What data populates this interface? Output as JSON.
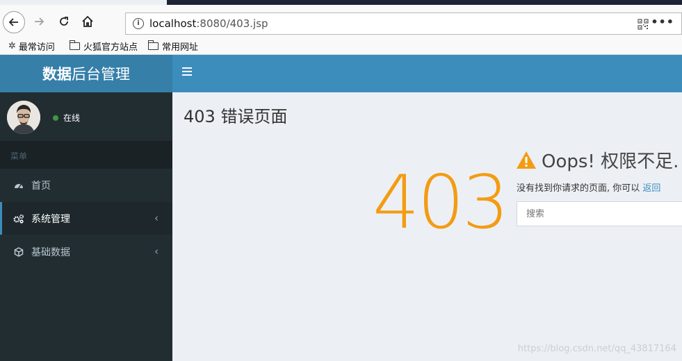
{
  "browser": {
    "url_host": "localhost",
    "url_path": ":8080/403.jsp",
    "more_label": "•••",
    "bookmarks": [
      {
        "label": "最常访问",
        "icon": "gear-icon"
      },
      {
        "label": "火狐官方站点",
        "icon": "folder-icon"
      },
      {
        "label": "常用网址",
        "icon": "folder-icon"
      }
    ]
  },
  "app": {
    "logo_bold": "数据",
    "logo_rest": "后台管理"
  },
  "sidebar": {
    "status": "在线",
    "menu_header": "菜单",
    "items": [
      {
        "label": "首页",
        "icon": "dashboard-icon"
      },
      {
        "label": "系统管理",
        "icon": "cogs-icon",
        "chevron": "‹"
      },
      {
        "label": "基础数据",
        "icon": "cube-icon",
        "chevron": "‹"
      }
    ]
  },
  "content": {
    "title": "403 错误页面",
    "code": "403",
    "oops": "Oops! 权限不足.",
    "message": "没有找到你请求的页面, 你可以 ",
    "link": "返回",
    "search_placeholder": "搜索"
  },
  "watermark": "https://blog.csdn.net/qq_43817164",
  "colors": {
    "logo_bg": "#367fa9",
    "header_bg": "#3c8dbc",
    "sidebar_bg": "#222d32",
    "accent_code": "#f39c12"
  }
}
